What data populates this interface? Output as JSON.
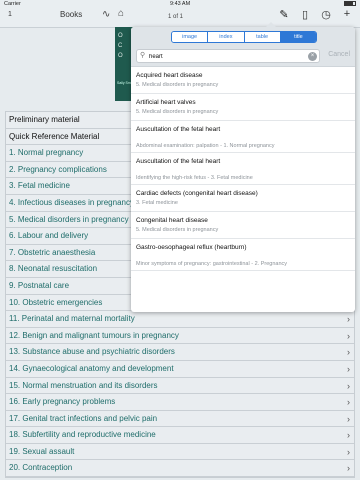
{
  "status": {
    "carrier": "Carrier",
    "time": "9:43 AM"
  },
  "toolbar": {
    "back": "1",
    "books": "Books",
    "page": "1 of 1"
  },
  "book": {
    "line1": "O",
    "line2": "C",
    "line3": "O",
    "sub": "Sally\nSmi"
  },
  "popover": {
    "segments": [
      "image",
      "index",
      "table",
      "title"
    ],
    "search_value": "heart",
    "cancel": "Cancel",
    "results": [
      {
        "title": "Acquired heart disease",
        "sub": "5. Medical disorders in pregnancy"
      },
      {
        "title": "Artificial heart valves",
        "sub": "5. Medical disorders in pregnancy"
      },
      {
        "title": "Auscultation of the fetal heart",
        "sub": "Abdominal examination: palpation - 1. Normal pregnancy"
      },
      {
        "title": "Auscultation of the fetal heart",
        "sub": "Identifying the high-risk fetus - 3. Fetal medicine"
      },
      {
        "title": "Cardiac defects (congenital heart disease)",
        "sub": "3. Fetal medicine"
      },
      {
        "title": "Congenital heart disease",
        "sub": "5. Medical disorders in pregnancy"
      },
      {
        "title": "Gastro-oesophageal reflux (heartburn)",
        "sub": "Minor symptoms of pregnancy: gastrointestinal - 2. Pregnancy"
      }
    ]
  },
  "contents": [
    {
      "label": "Preliminary material",
      "header": true
    },
    {
      "label": "Quick Reference Material",
      "header": true
    },
    {
      "label": "1. Normal pregnancy"
    },
    {
      "label": "2. Pregnancy complications"
    },
    {
      "label": "3. Fetal medicine"
    },
    {
      "label": "4. Infectious diseases in pregnancy"
    },
    {
      "label": "5. Medical disorders in pregnancy"
    },
    {
      "label": "6. Labour and delivery"
    },
    {
      "label": "7. Obstetric anaesthesia"
    },
    {
      "label": "8. Neonatal resuscitation"
    },
    {
      "label": "9. Postnatal care"
    },
    {
      "label": "10. Obstetric emergencies",
      "chev": true
    },
    {
      "label": "11. Perinatal and maternal mortality",
      "chev": true
    },
    {
      "label": "12. Benign and malignant tumours in pregnancy",
      "chev": true
    },
    {
      "label": "13. Substance abuse and psychiatric disorders",
      "chev": true
    },
    {
      "label": "14. Gynaecological anatomy and development",
      "chev": true
    },
    {
      "label": "15. Normal menstruation and its disorders",
      "chev": true
    },
    {
      "label": "16. Early pregnancy problems",
      "chev": true
    },
    {
      "label": "17. Genital tract infections and pelvic pain",
      "chev": true
    },
    {
      "label": "18. Subfertility and reproductive medicine",
      "chev": true
    },
    {
      "label": "19. Sexual assault",
      "chev": true
    },
    {
      "label": "20. Contraception",
      "chev": true
    }
  ]
}
